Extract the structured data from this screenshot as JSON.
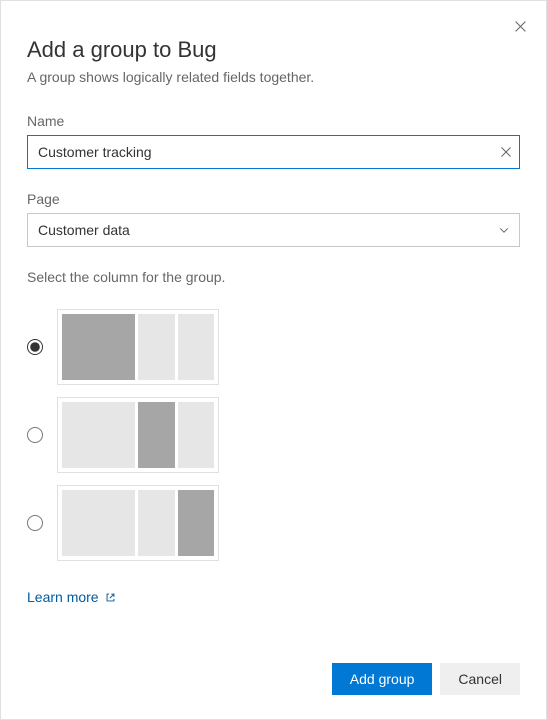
{
  "dialog": {
    "title": "Add a group to Bug",
    "subtitle": "A group shows logically related fields together."
  },
  "name_field": {
    "label": "Name",
    "value": "Customer tracking"
  },
  "page_field": {
    "label": "Page",
    "value": "Customer data"
  },
  "column_section": {
    "helper": "Select the column for the group.",
    "selected_index": 0
  },
  "learn_more": {
    "label": "Learn more"
  },
  "footer": {
    "primary": "Add group",
    "secondary": "Cancel"
  }
}
